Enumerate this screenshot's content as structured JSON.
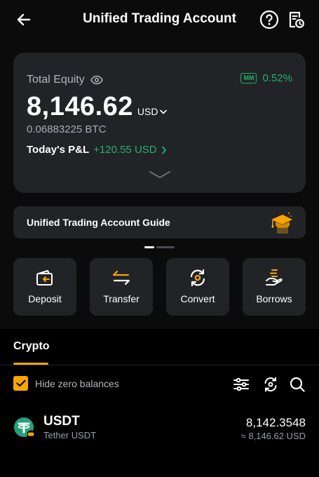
{
  "header": {
    "title": "Unified Trading Account",
    "back_icon": "arrow-left-icon",
    "help_icon": "question-circle-icon",
    "history_icon": "document-clock-icon"
  },
  "equity": {
    "label": "Total Equity",
    "amount": "8,146.62",
    "currency": "USD",
    "btc_value": "0.06883225 BTC",
    "mm_badge": "MM",
    "mm_ratio": "0.52%",
    "pnl_label": "Today's P&L",
    "pnl_value": "+120.55 USD"
  },
  "guide": {
    "title": "Unified Trading Account Guide",
    "icon": "graduation-cap-icon"
  },
  "pager": {
    "pages": 2,
    "active": 0
  },
  "actions": [
    {
      "label": "Deposit",
      "icon": "deposit-icon"
    },
    {
      "label": "Transfer",
      "icon": "transfer-arrows-icon"
    },
    {
      "label": "Convert",
      "icon": "convert-icon"
    },
    {
      "label": "Borrows",
      "icon": "borrow-hand-icon"
    }
  ],
  "tabs": [
    {
      "label": "Crypto",
      "active": true
    }
  ],
  "filters": {
    "hide_zero_label": "Hide zero balances",
    "hide_zero_checked": true
  },
  "assets": [
    {
      "symbol": "USDT",
      "name": "Tether USDT",
      "balance": "8,142.3548",
      "usd_value": "≈ 8,146.62 USD"
    }
  ],
  "colors": {
    "background": "#000000",
    "card": "#222327",
    "accent": "#f7a600",
    "positive": "#20b26c",
    "text_muted": "#b3b6bd"
  }
}
